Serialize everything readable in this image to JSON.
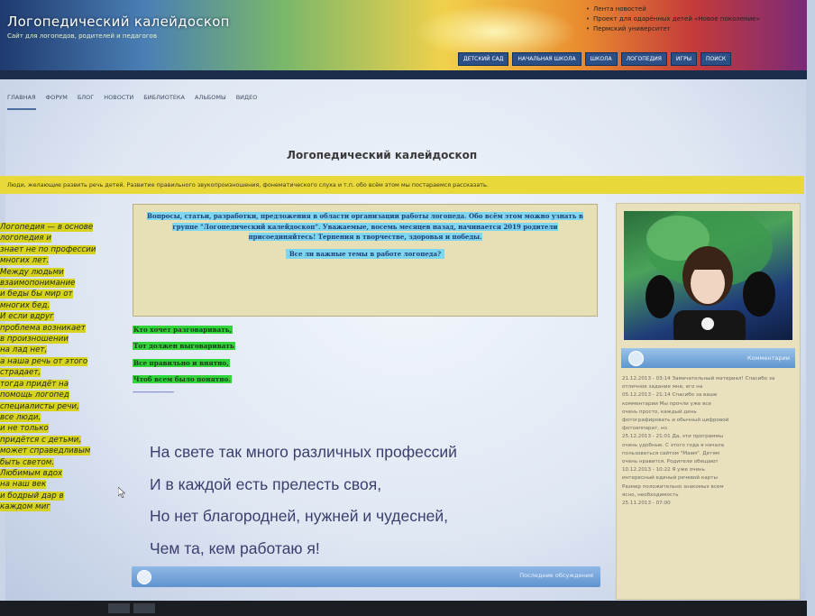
{
  "header": {
    "site_title": "Логопедический калейдоскоп",
    "site_subtitle": "Сайт для логопедов, родителей и педагогов",
    "news": [
      "Лента новостей",
      "Проект для одарённых детей «Новое поколение»",
      "Пермский университет"
    ],
    "top_nav": [
      "ДЕТСКИЙ САД",
      "НАЧАЛЬНАЯ ШКОЛА",
      "ШКОЛА",
      "ЛОГОПЕДИЯ",
      "ИГРЫ",
      "ПОИСК"
    ]
  },
  "menu": {
    "items": [
      "ГЛАВНАЯ",
      "ФОРУМ",
      "БЛОГ",
      "НОВОСТИ",
      "БИБЛИОТЕКА",
      "АЛЬБОМЫ",
      "ВИДЕО"
    ]
  },
  "main": {
    "page_heading": "Логопедический калейдоскоп",
    "yellow_strip": "Люди, желающие развить речь детей. Развитие правильного звукопроизношения, фонематического слуха и т.п. обо всём этом мы постараемся рассказать.",
    "left_column": [
      "Логопедия — в основе",
      "логопедия и",
      "знает не по профессии",
      "многих лет.",
      "Между людьми",
      "взаимопонимание",
      "и беды бы мир от",
      "многих бед.",
      "И если вдруг",
      "проблема возникает",
      "в произношении",
      "на лад нет,",
      "а наша речь от этого",
      "страдает,",
      "тогда придёт на",
      "помощь логопед",
      "специалисты речи,",
      "все люди,",
      "и не только",
      "придётся с детьми,",
      "может справедливым",
      "быть светом.",
      "Любимым вдох",
      "на наш век",
      "и бодрый дар в",
      "каждом миг"
    ],
    "notice": {
      "text": "Вопросы, статьи, разработки, предложения в области организации работы логопеда. Обо всём этом можно узнать в группе \"Логопедический калейдоскоп\". Уважаемые, восемь месяцев назад, начинается 2019 родители присоединяйтесь! Терпения в творчестве, здоровья и победы.",
      "question": "Все ли важные темы в работе логопеда?"
    },
    "green_lines": [
      "Кто хочет разговаривать,",
      "Тот должен выговаривать",
      "Все правильно и внятно,",
      "Чтоб всем было понятно."
    ],
    "dashes": "------------------------",
    "poem": [
      "На свете так много различных профессий",
      "И в каждой есть прелесть своя,",
      "Но нет благородней, нужней и чудесней,",
      "Чем та, кем работаю я!"
    ],
    "bottom_bar_label": "Последние обсуждения"
  },
  "sidebar": {
    "widget_title": "Комментарии",
    "comments": [
      "21.12.2013 - 03:14 Замечательный материал! Спасибо за отличное задание мне, его на",
      "05.12.2013 - 21:14 Спасибо за ваше",
      "комментарии Мы прочли уже все",
      "очень просто, каждый день",
      "фотографировать и обычный цифровой",
      "фотоаппарат, но",
      "25.12.2013 - 21:01 Да, эти программы",
      "очень удобные. С этого года я начала",
      "пользоваться сайтом \"Маам\". Детям",
      "очень нравится. Родители обещают",
      "10.12.2013 - 10:22 Я уже очень",
      "интересный единый речевой карты",
      "Размер положительно знакомых всем",
      "ясно, необходимость",
      "25.11.2013 - 07:00"
    ]
  },
  "colors": {
    "highlight_yellow": "#d7d21e",
    "highlight_green": "#33d33a",
    "highlight_cyan": "#7fd6ef",
    "poem_text": "#3a3f6e"
  }
}
